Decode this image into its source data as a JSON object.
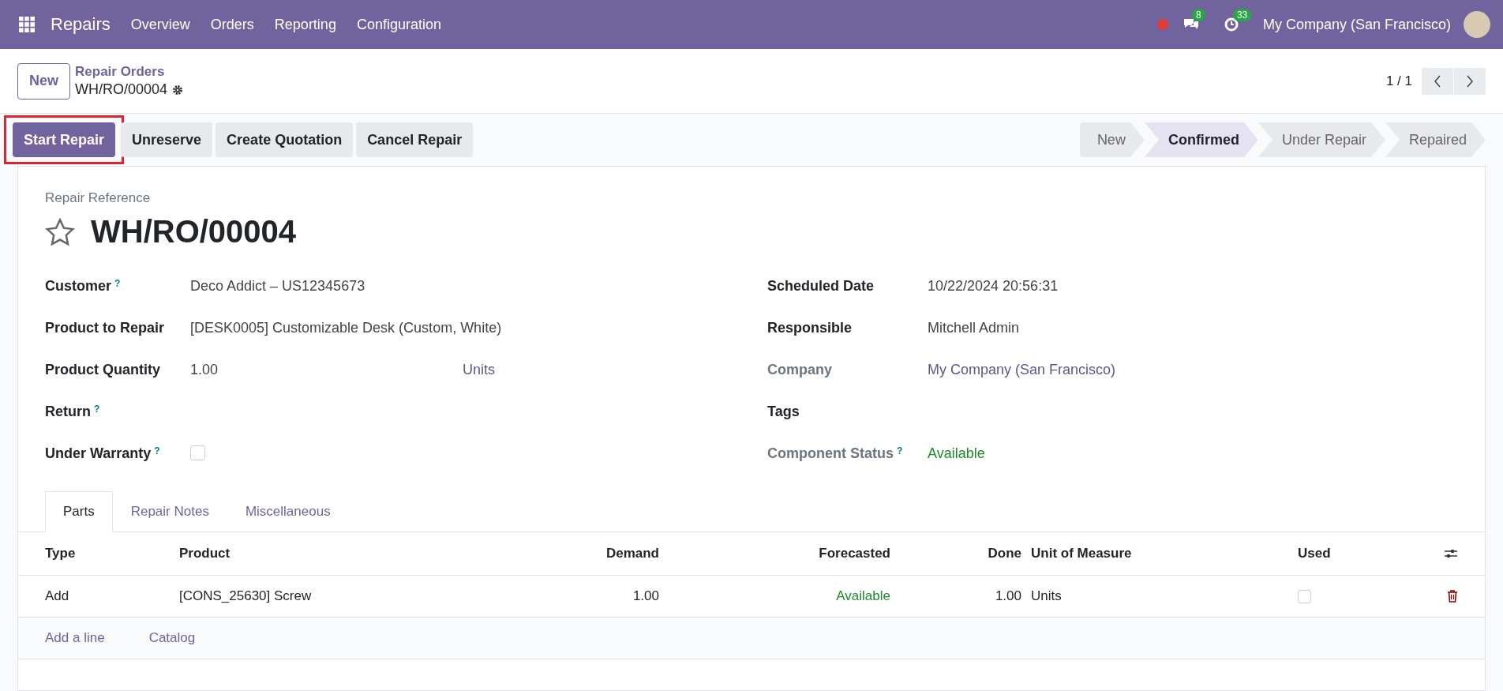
{
  "navbar": {
    "app_name": "Repairs",
    "menu": [
      "Overview",
      "Orders",
      "Reporting",
      "Configuration"
    ],
    "messages_count": "8",
    "activities_count": "33",
    "company": "My Company (San Francisco)"
  },
  "breadcrumb": {
    "new_button": "New",
    "parent": "Repair Orders",
    "current": "WH/RO/00004"
  },
  "pager": {
    "value": "1 / 1"
  },
  "actions": [
    {
      "label": "Start Repair",
      "primary": true,
      "highlighted": true
    },
    {
      "label": "Unreserve",
      "primary": false,
      "highlighted": false
    },
    {
      "label": "Create Quotation",
      "primary": false,
      "highlighted": false
    },
    {
      "label": "Cancel Repair",
      "primary": false,
      "highlighted": false
    }
  ],
  "stages": [
    {
      "label": "New",
      "selected": false
    },
    {
      "label": "Confirmed",
      "selected": true
    },
    {
      "label": "Under Repair",
      "selected": false
    },
    {
      "label": "Repaired",
      "selected": false
    }
  ],
  "form": {
    "reference_label": "Repair Reference",
    "reference": "WH/RO/00004",
    "starred": false,
    "left_fields": [
      {
        "label": "Customer",
        "help": "?",
        "kind": "text",
        "value": "Deco Addict – US12345673"
      },
      {
        "label": "Product to Repair",
        "kind": "text",
        "value": "[DESK0005] Customizable Desk (Custom, White)"
      },
      {
        "label": "Product Quantity",
        "kind": "quantity",
        "value": "1.00",
        "unit": "Units"
      },
      {
        "label": "Return",
        "help": "?",
        "kind": "text"
      },
      {
        "label": "Under Warranty",
        "help": "?",
        "kind": "checkbox",
        "checked": false
      }
    ],
    "right_fields": [
      {
        "label": "Scheduled Date",
        "kind": "text",
        "value": "10/22/2024 20:56:31",
        "readonly": false
      },
      {
        "label": "Responsible",
        "kind": "text",
        "value": "Mitchell Admin",
        "readonly": false
      },
      {
        "label": "Company",
        "kind": "link",
        "value": "My Company (San Francisco)",
        "readonly": true
      },
      {
        "label": "Tags",
        "kind": "text",
        "readonly": false
      },
      {
        "label": "Component Status",
        "help": "?",
        "kind": "status",
        "value": "Available",
        "readonly": true
      }
    ]
  },
  "tabs": [
    {
      "label": "Parts",
      "selected": true
    },
    {
      "label": "Repair Notes",
      "selected": false
    },
    {
      "label": "Miscellaneous",
      "selected": false
    }
  ],
  "table": {
    "columns": [
      "Type",
      "Product",
      "Demand",
      "Forecasted",
      "Done",
      "Unit of Measure",
      "Used"
    ],
    "rows": [
      {
        "type": "Add",
        "product": "[CONS_25630] Screw",
        "demand": "1.00",
        "forecasted": "Available",
        "done": "1.00",
        "uom": "Units",
        "used": false
      }
    ],
    "add_links": [
      "Add a line",
      "Catalog"
    ]
  }
}
